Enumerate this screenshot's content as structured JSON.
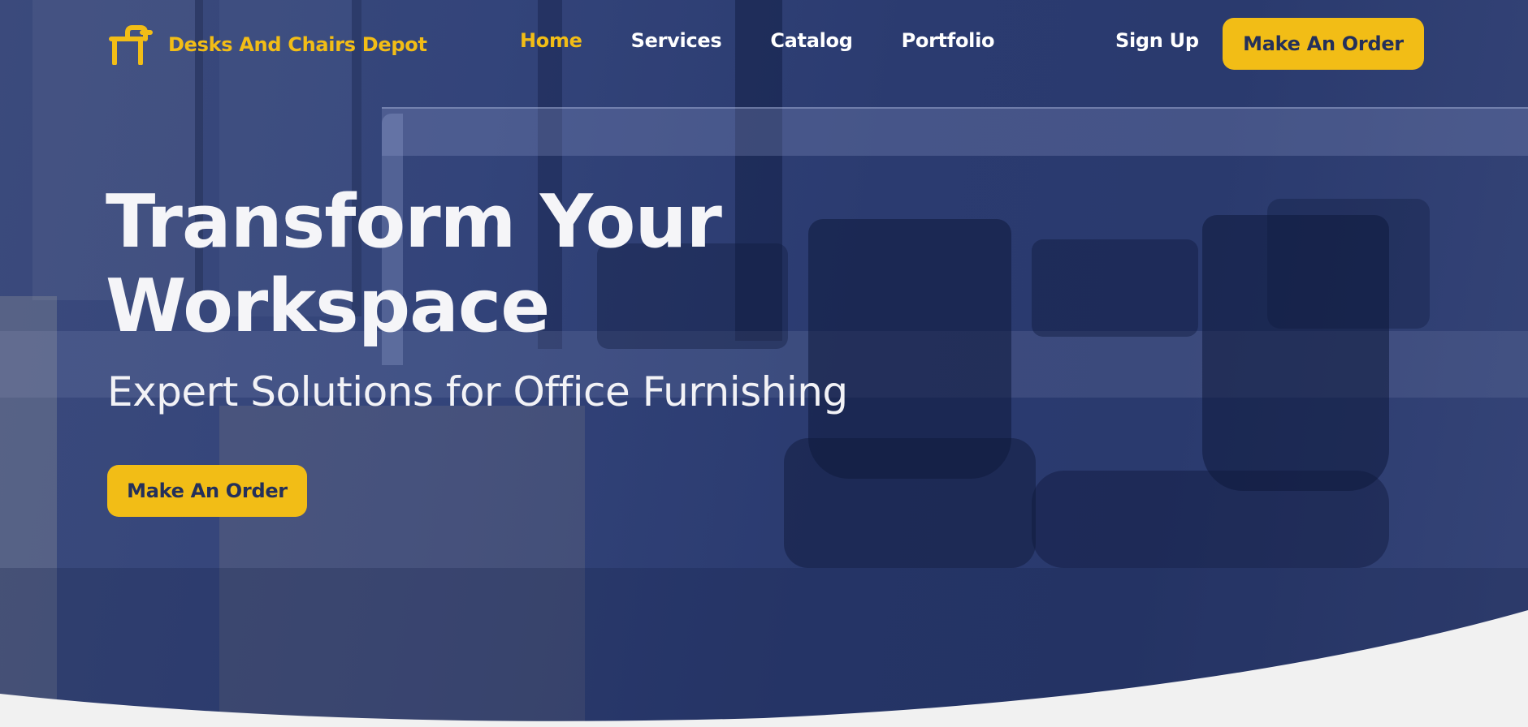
{
  "brand": {
    "name": "Desks And Chairs Depot",
    "logo_icon": "desk-chair-logo-icon",
    "accent_color": "#f2bd16"
  },
  "nav": {
    "links": [
      {
        "label": "Home",
        "active": true
      },
      {
        "label": "Services",
        "active": false
      },
      {
        "label": "Catalog",
        "active": false
      },
      {
        "label": "Portfolio",
        "active": false
      }
    ],
    "signup_label": "Sign Up",
    "cta_label": "Make An Order"
  },
  "hero": {
    "headline_line1": "Transform Your",
    "headline_line2": "Workspace",
    "subheadline": "Expert Solutions for Office Furnishing",
    "cta_label": "Make An Order",
    "overlay_color": "#2b3b70"
  },
  "colors": {
    "cta_background": "#f2bd16",
    "cta_text": "#24305a",
    "page_background": "#f1f1f1"
  }
}
